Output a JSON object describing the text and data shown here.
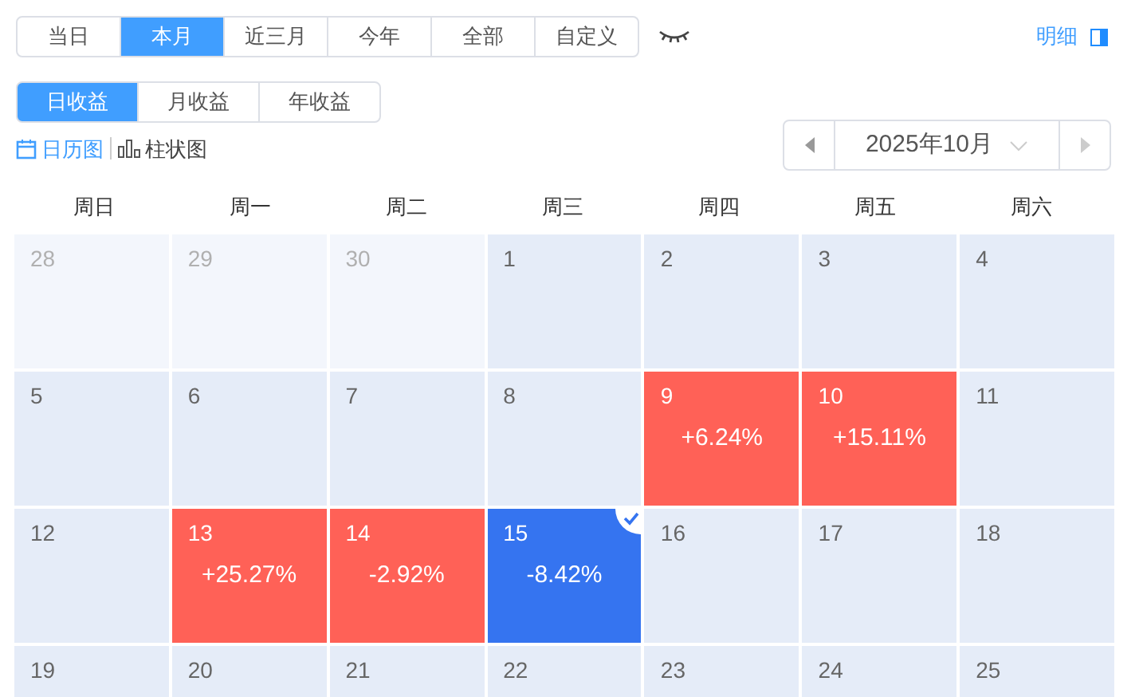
{
  "range_tabs": [
    {
      "label": "当日",
      "selected": false
    },
    {
      "label": "本月",
      "selected": true
    },
    {
      "label": "近三月",
      "selected": false
    },
    {
      "label": "今年",
      "selected": false
    },
    {
      "label": "全部",
      "selected": false
    },
    {
      "label": "自定义",
      "selected": false
    }
  ],
  "detail_link": "明细",
  "income_tabs": [
    {
      "label": "日收益",
      "selected": true
    },
    {
      "label": "月收益",
      "selected": false
    },
    {
      "label": "年收益",
      "selected": false
    }
  ],
  "view_toggle": [
    {
      "label": "日历图",
      "selected": true,
      "kind": "calendar"
    },
    {
      "label": "柱状图",
      "selected": false,
      "kind": "bar"
    }
  ],
  "month_picker": {
    "value": "2025年10月"
  },
  "weekdays": [
    "周日",
    "周一",
    "周二",
    "周三",
    "周四",
    "周五",
    "周六"
  ],
  "days": [
    {
      "day": "28",
      "kind": "other",
      "selected": false
    },
    {
      "day": "29",
      "kind": "other",
      "selected": false
    },
    {
      "day": "30",
      "kind": "other",
      "selected": false
    },
    {
      "day": "1",
      "kind": "current",
      "selected": false
    },
    {
      "day": "2",
      "kind": "current",
      "selected": false
    },
    {
      "day": "3",
      "kind": "current",
      "selected": false
    },
    {
      "day": "4",
      "kind": "current",
      "selected": false
    },
    {
      "day": "5",
      "kind": "current",
      "selected": false
    },
    {
      "day": "6",
      "kind": "current",
      "selected": false
    },
    {
      "day": "7",
      "kind": "current",
      "selected": false
    },
    {
      "day": "8",
      "kind": "current",
      "selected": false
    },
    {
      "day": "9",
      "kind": "current",
      "selected": false,
      "change": "+6.24%",
      "color": "#ff6157"
    },
    {
      "day": "10",
      "kind": "current",
      "selected": false,
      "change": "+15.11%",
      "color": "#ff6157"
    },
    {
      "day": "11",
      "kind": "current",
      "selected": false
    },
    {
      "day": "12",
      "kind": "current",
      "selected": false
    },
    {
      "day": "13",
      "kind": "current",
      "selected": false,
      "change": "+25.27%",
      "color": "#ff6157"
    },
    {
      "day": "14",
      "kind": "current",
      "selected": false,
      "change": "-2.92%",
      "color": "#ff6157"
    },
    {
      "day": "15",
      "kind": "current",
      "selected": true,
      "change": "-8.42%"
    },
    {
      "day": "16",
      "kind": "current",
      "selected": false
    },
    {
      "day": "17",
      "kind": "current",
      "selected": false
    },
    {
      "day": "18",
      "kind": "current",
      "selected": false
    },
    {
      "day": "19",
      "kind": "current",
      "selected": false
    },
    {
      "day": "20",
      "kind": "current",
      "selected": false
    },
    {
      "day": "21",
      "kind": "current",
      "selected": false
    },
    {
      "day": "22",
      "kind": "current",
      "selected": false
    },
    {
      "day": "23",
      "kind": "current",
      "selected": false
    },
    {
      "day": "24",
      "kind": "current",
      "selected": false
    },
    {
      "day": "25",
      "kind": "current",
      "selected": false
    }
  ]
}
